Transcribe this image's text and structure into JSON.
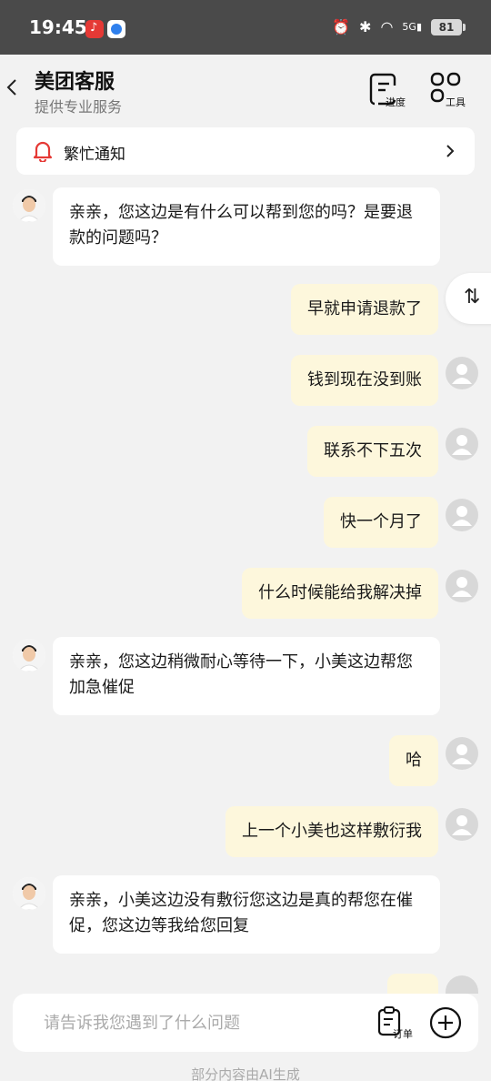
{
  "status": {
    "time": "19:45",
    "battery": "81",
    "network": "5G"
  },
  "header": {
    "title": "美团客服",
    "subtitle": "提供专业服务",
    "progress_label": "进度",
    "tools_label": "工具"
  },
  "notice": {
    "text": "繁忙通知"
  },
  "messages": [
    {
      "from": "bot",
      "text": "亲亲，您这边是有什么可以帮到您的吗？是要退款的问题吗？"
    },
    {
      "from": "user",
      "text": "早就申请退款了"
    },
    {
      "from": "user",
      "text": "钱到现在没到账"
    },
    {
      "from": "user",
      "text": "联系不下五次"
    },
    {
      "from": "user",
      "text": "快一个月了"
    },
    {
      "from": "user",
      "text": "什么时候能给我解决掉"
    },
    {
      "from": "bot",
      "text": "亲亲，您这边稍微耐心等待一下，小美这边帮您加急催促"
    },
    {
      "from": "user",
      "text": "哈"
    },
    {
      "from": "user",
      "text": "上一个小美也这样敷衍我"
    },
    {
      "from": "bot",
      "text": "亲亲，小美这边没有敷衍您这边是真的帮您在催促，您这边等我给您回复"
    }
  ],
  "float_button": {
    "glyph": "⇅"
  },
  "input": {
    "placeholder": "请告诉我您遇到了什么问题",
    "value": "",
    "order_label": "订单"
  },
  "footer": {
    "note": "部分内容由AI生成"
  },
  "colors": {
    "user_bubble": "#fdf7dc",
    "bot_bubble": "#ffffff",
    "bell": "#e53935",
    "background": "#f2f2f2"
  }
}
